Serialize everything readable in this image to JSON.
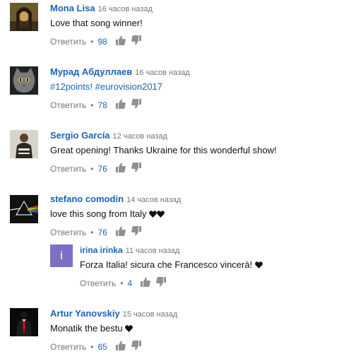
{
  "comments": [
    {
      "author": "Mona Lisa",
      "time": "16 часов назад",
      "text": "Love that song winner!",
      "reply_label": "Ответить",
      "likes": "98",
      "avatar": "mona-lisa-portrait"
    },
    {
      "author": "Мурад Абдуллаев",
      "time": "16 часов назад",
      "text": "#12points! #eurovision2017",
      "reply_label": "Ответить",
      "likes": "78",
      "avatar": "cat-photo"
    },
    {
      "author": "Sergio García",
      "time": "12 часов назад",
      "text": "Great opening! Thanks Ukraine for this wonderful show!",
      "reply_label": "Ответить",
      "likes": "76",
      "avatar": "person-photo"
    },
    {
      "author": "stefano comodin",
      "time": "14 часов назад",
      "text": "love this song from Italy",
      "reply_label": "Ответить",
      "likes": "76",
      "avatar": "prism-album-art"
    },
    {
      "author": "irina irinka",
      "time": "11 часов назад",
      "text": "Forza Italia!  sicura che Francesco vincerà!",
      "reply_label": "Ответить",
      "likes": "4",
      "avatar_letter": "i",
      "avatar_color": "#7e6fc4"
    },
    {
      "author": "Artur Yanovskiy",
      "time": "15 часов назад",
      "text": "Monatik the bestu",
      "reply_label": "Ответить",
      "likes": "65",
      "avatar": "dark-suit-figure"
    }
  ],
  "colors": {
    "author": "#1c62b9",
    "meta": "#767676",
    "text": "#111111",
    "icon": "#909090"
  },
  "icons": {
    "like": "thumb-up-icon",
    "dislike": "thumb-down-icon",
    "heart": "heart-icon"
  }
}
